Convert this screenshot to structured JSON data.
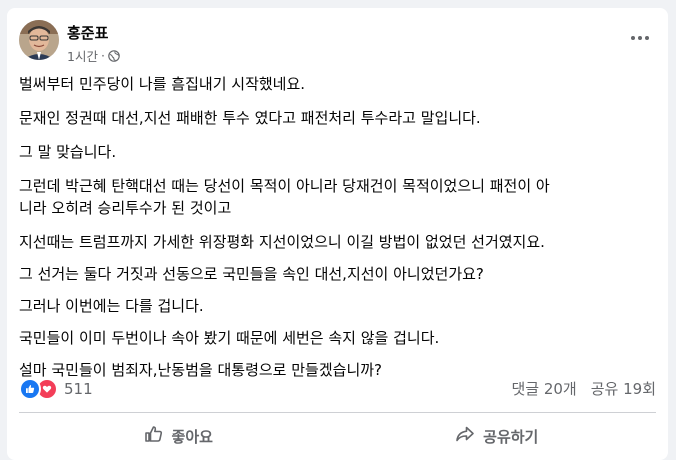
{
  "post": {
    "author": "홍준표",
    "time": "1시간",
    "separator": "·",
    "lines": [
      "벌써부터 민주당이 나를 흠집내기 시작했네요.",
      "문재인 정권때 대선,지선 패배한 투수 였다고 패전처리 투수라고 말입니다.",
      "그 말 맞습니다.",
      "그런데 박근혜 탄핵대선 때는 당선이 목적이 아니라 당재건이 목적이었으니 패전이 아",
      "니라 오히려 승리투수가 된 것이고",
      "지선때는 트럼프까지 가세한 위장평화 지선이었으니 이길 방법이 없었던 선거였지요.",
      "그 선거는 둘다 거짓과 선동으로 국민들을 속인 대선,지선이 아니었던가요?",
      "그러나 이번에는 다를 겁니다.",
      "국민들이 이미 두번이나 속아 봤기 때문에 세번은 속지 않을 겁니다.",
      "설마 국민들이 범죄자,난동범을 대통령으로 만들겠습니까?"
    ]
  },
  "stats": {
    "reaction_count": "511",
    "comments": "댓글 20개",
    "shares": "공유 19회"
  },
  "actions": {
    "like_label": "좋아요",
    "share_label": "공유하기"
  },
  "icons": {
    "reactions": [
      "like-icon",
      "love-icon"
    ],
    "privacy": "globe-icon"
  },
  "colors": {
    "like_blue": "#1877f2",
    "love_red": "#f33e58",
    "secondary_text": "#65676b"
  }
}
